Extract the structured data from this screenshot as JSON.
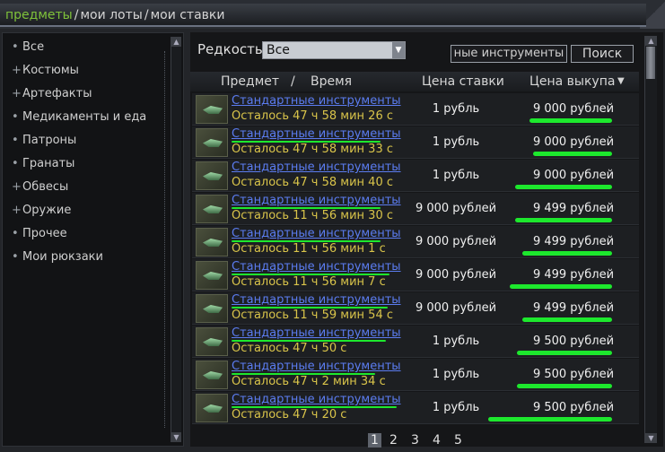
{
  "tabs": [
    {
      "label": "предметы",
      "active": true
    },
    {
      "label": "мои лоты",
      "active": false
    },
    {
      "label": "мои ставки",
      "active": false
    }
  ],
  "tab_separator": "/",
  "categories": [
    {
      "marker": "•",
      "label": "Все"
    },
    {
      "marker": "+",
      "label": "Костюмы"
    },
    {
      "marker": "+",
      "label": "Артефакты"
    },
    {
      "marker": "•",
      "label": "Медикаменты и еда"
    },
    {
      "marker": "•",
      "label": "Патроны"
    },
    {
      "marker": "•",
      "label": "Гранаты"
    },
    {
      "marker": "+",
      "label": "Обвесы"
    },
    {
      "marker": "+",
      "label": "Оружие"
    },
    {
      "marker": "•",
      "label": "Прочее"
    },
    {
      "marker": "•",
      "label": "Мои рюкзаки"
    }
  ],
  "filter": {
    "label": "Редкость",
    "selected": "Все",
    "dropdown_icon": "triangle-down"
  },
  "search_input_value": "ные инструменты",
  "search_button": "Поиск",
  "columns": {
    "item": "Предмет",
    "separator": "/",
    "time": "Время",
    "bid_price": "Цена ставки",
    "buyout_price": "Цена выкупа",
    "sort_icon": "▼"
  },
  "rows": [
    {
      "name": "Стандартные инструменты",
      "time": "Осталось 47 ч 58 мин 26 с",
      "bid": "1 рубль",
      "buyout": "9 000 рублей"
    },
    {
      "name": "Стандартные инструменты",
      "time": "Осталось 47 ч 58 мин 33 с",
      "bid": "1 рубль",
      "buyout": "9 000 рублей"
    },
    {
      "name": "Стандартные инструменты",
      "time": "Осталось 47 ч 58 мин 40 с",
      "bid": "1 рубль",
      "buyout": "9 000 рублей"
    },
    {
      "name": "Стандартные инструменты",
      "time": "Осталось 11 ч 56 мин 30 с",
      "bid": "9 000 рублей",
      "buyout": "9 499 рублей"
    },
    {
      "name": "Стандартные инструменты",
      "time": "Осталось 11 ч 56 мин 1 с",
      "bid": "9 000 рублей",
      "buyout": "9 499 рублей"
    },
    {
      "name": "Стандартные инструменты",
      "time": "Осталось 11 ч 56 мин 7 с",
      "bid": "9 000 рублей",
      "buyout": "9 499 рублей"
    },
    {
      "name": "Стандартные инструменты",
      "time": "Осталось 11 ч 59 мин 54 с",
      "bid": "9 000 рублей",
      "buyout": "9 499 рублей"
    },
    {
      "name": "Стандартные инструменты",
      "time": "Осталось 47 ч 50 с",
      "bid": "1 рубль",
      "buyout": "9 500 рублей"
    },
    {
      "name": "Стандартные инструменты",
      "time": "Осталось 47 ч 2 мин 34 с",
      "bid": "1 рубль",
      "buyout": "9 500 рублей"
    },
    {
      "name": "Стандартные инструменты",
      "time": "Осталось 47 ч 20 с",
      "bid": "1 рубль",
      "buyout": "9 500 рублей"
    }
  ],
  "pages": [
    "1",
    "2",
    "3",
    "4",
    "5"
  ],
  "current_page": "1",
  "colors": {
    "active_tab": "#7ec23a",
    "item_link": "#5b7cf0",
    "time_left": "#d9c44a",
    "highlight_stroke": "#1de82d"
  }
}
